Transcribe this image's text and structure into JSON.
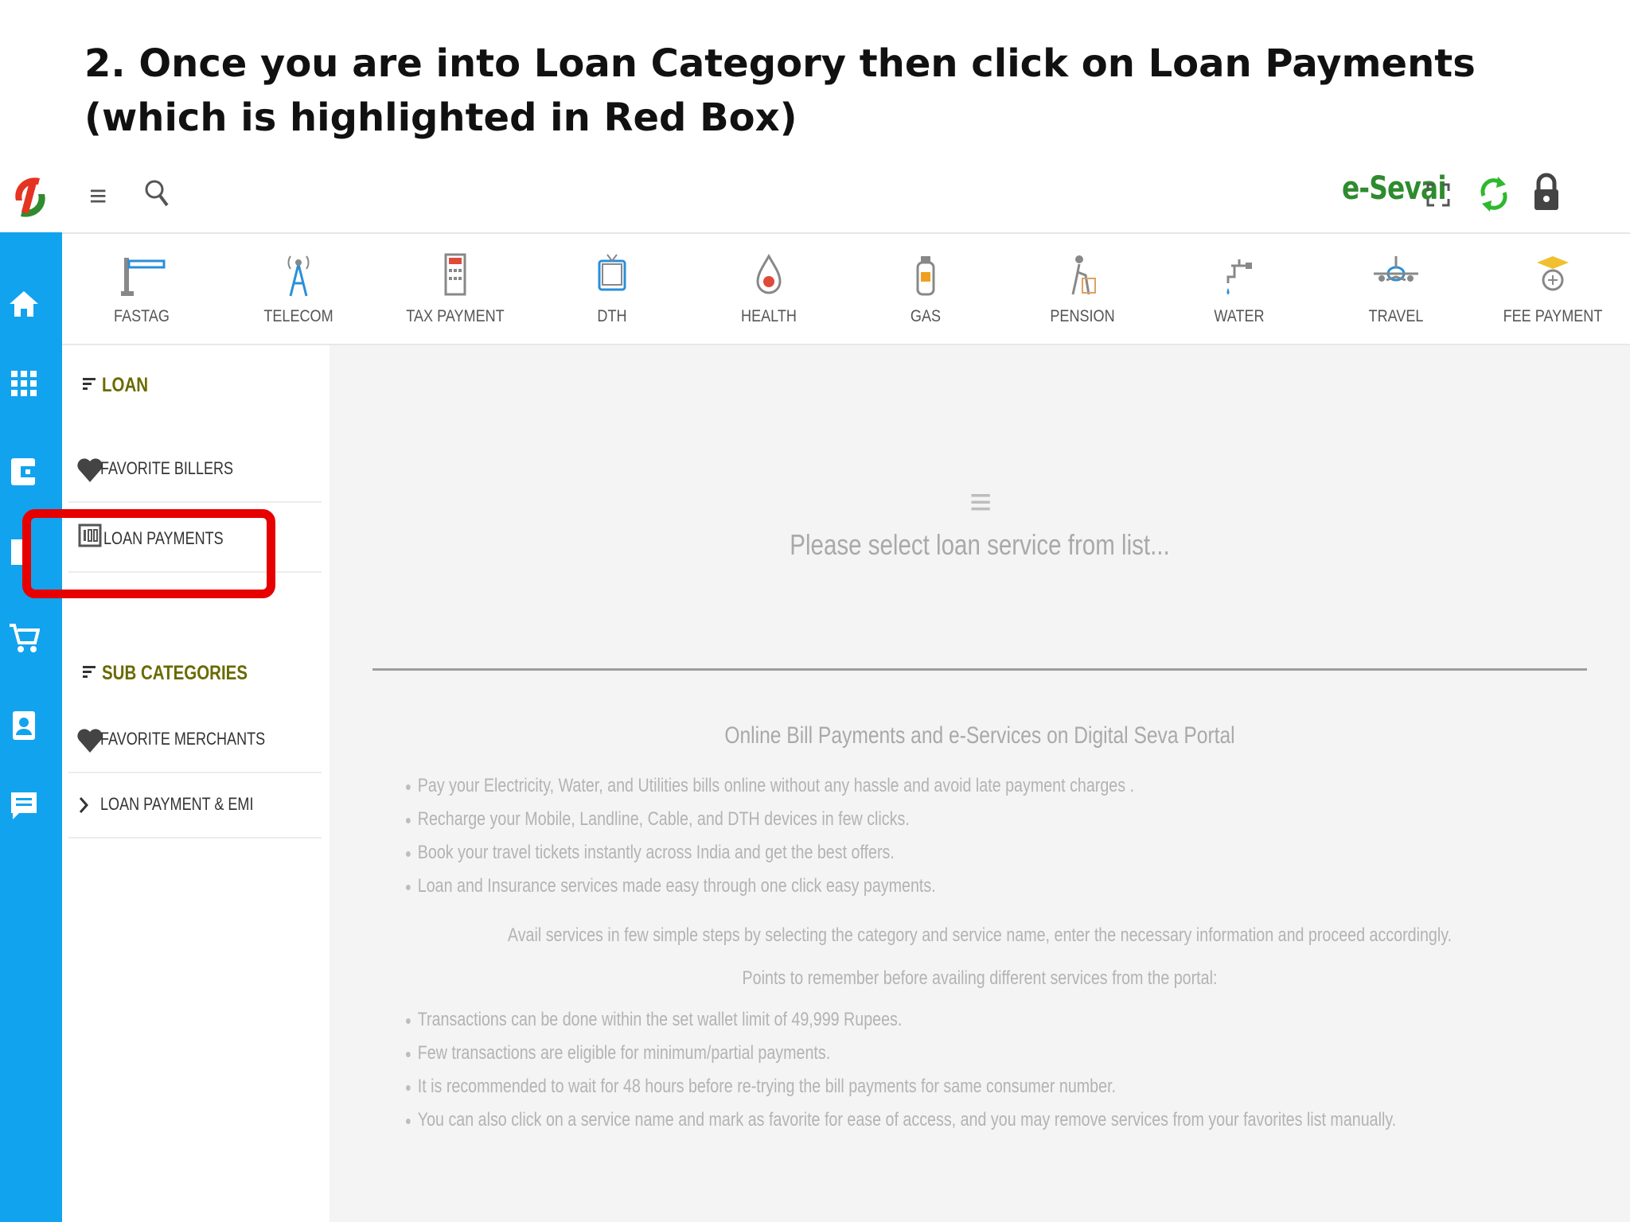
{
  "slide": {
    "title": "2. Once you are into Loan Category then click on Loan Payments  (which is highlighted in Red Box)"
  },
  "topbar": {
    "brand": "e-Sevai",
    "icons": [
      "hamburger-menu-icon",
      "search-icon",
      "fullscreen-icon",
      "refresh-icon",
      "lock-icon"
    ]
  },
  "categories": [
    {
      "label": "FASTAG",
      "icon": "toll-gate-icon"
    },
    {
      "label": "TELECOM",
      "icon": "antenna-tower-icon"
    },
    {
      "label": "TAX PAYMENT",
      "icon": "tax-calculator-icon"
    },
    {
      "label": "DTH",
      "icon": "tv-icon"
    },
    {
      "label": "HEALTH",
      "icon": "blood-drop-icon"
    },
    {
      "label": "GAS",
      "icon": "gas-cylinder-icon"
    },
    {
      "label": "PENSION",
      "icon": "elderly-person-icon"
    },
    {
      "label": "WATER",
      "icon": "water-tap-icon"
    },
    {
      "label": "TRAVEL",
      "icon": "airplane-icon"
    },
    {
      "label": "FEE PAYMENT",
      "icon": "graduation-icon"
    }
  ],
  "left_panel": {
    "loan_heading": "LOAN",
    "favorite_billers": "FAVORITE BILLERS",
    "loan_payments": "LOAN PAYMENTS",
    "sub_categories_heading": "SUB CATEGORIES",
    "favorite_merchants": "FAVORITE MERCHANTS",
    "loan_payment_emi": "LOAN PAYMENT & EMI"
  },
  "main": {
    "empty_message": "Please select loan service from list...",
    "info_title": "Online Bill Payments and e-Services on Digital Seva Portal",
    "bullets_1": [
      "Pay your Electricity, Water, and Utilities bills online without any hassle and avoid late payment charges .",
      "Recharge your Mobile, Landline, Cable, and DTH devices in few clicks.",
      "Book your travel tickets instantly across India and get the best offers.",
      "Loan and Insurance services made easy through one click easy payments."
    ],
    "avail_text": "Avail services in few simple steps by selecting the category and service name, enter the necessary information and proceed accordingly.",
    "points_heading": "Points to remember before availing different services from the portal:",
    "bullets_2": [
      "Transactions can be done within the set wallet limit of 49,999 Rupees.",
      "Few transactions are eligible for minimum/partial payments.",
      "It is recommended to wait for 48 hours before re-trying the bill payments for same consumer number.",
      "You can also click on a service name and mark as favorite for ease of access, and you may remove services from your favorites list manually."
    ]
  },
  "colors": {
    "rail": "#12a3ee",
    "brand": "#2e8b2e",
    "highlight": "#e60000",
    "heading": "#6a6a00"
  }
}
